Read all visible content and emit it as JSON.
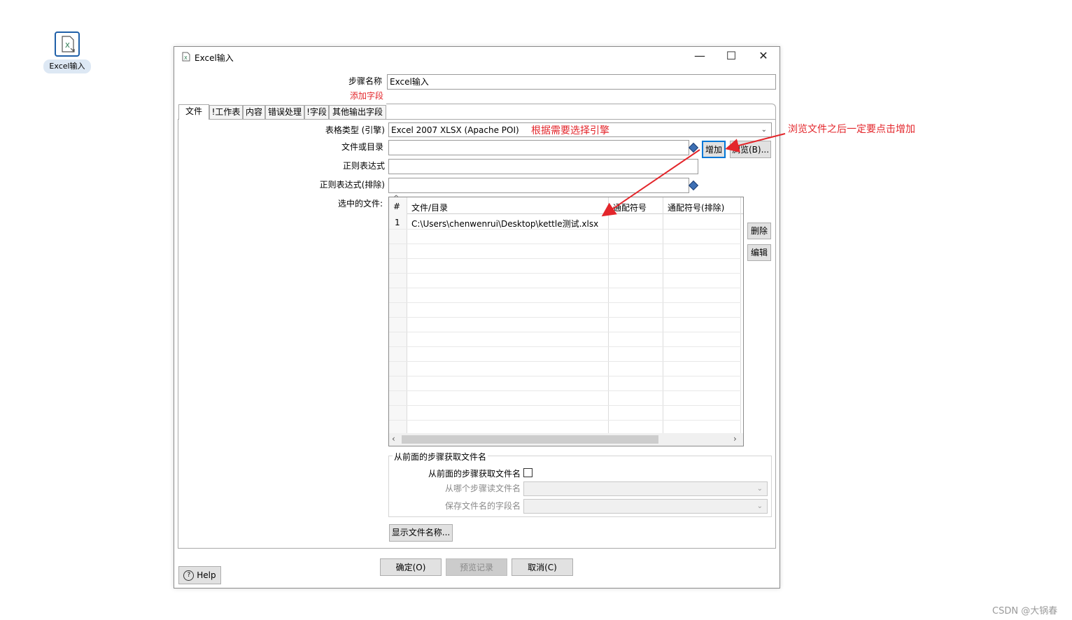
{
  "desktop": {
    "step_label": "Excel输入"
  },
  "dialog": {
    "title": "Excel输入",
    "controls": {
      "minimize": "—",
      "maximize": "☐",
      "close": "✕"
    },
    "step_name_label": "步骤名称",
    "step_name_value": "Excel输入",
    "add_fields_label": "添加字段",
    "tabs": [
      "文件",
      "!工作表",
      "内容",
      "错误处理",
      "!字段",
      "其他输出字段"
    ],
    "file_tab": {
      "spreadsheet_type_label": "表格类型 (引擎)",
      "spreadsheet_type_value": "Excel 2007 XLSX (Apache POI)",
      "file_or_dir_label": "文件或目录",
      "file_or_dir_value": "",
      "regex_label": "正则表达式",
      "regex_value": "",
      "regex_exclude_label": "正则表达式(排除)",
      "regex_exclude_value": "",
      "selected_files_label": "选中的文件:",
      "add_button": "增加",
      "browse_button": "浏览(B)...",
      "delete_button": "删除",
      "edit_button": "编辑",
      "table": {
        "columns": [
          "#",
          "文件/目录",
          "通配符号",
          "通配符号(排除)"
        ],
        "rows": [
          {
            "num": "1",
            "path": "C:\\Users\\chenwenrui\\Desktop\\kettle测试.xlsx",
            "wildcard": "",
            "wildcard_exclude": ""
          }
        ]
      },
      "prev_step_group_label": "从前面的步骤获取文件名",
      "prev_step_checkbox_label": "从前面的步骤获取文件名",
      "read_from_step_label": "从哪个步骤读文件名",
      "filename_field_label": "保存文件名的字段名",
      "show_filenames_button": "显示文件名称..."
    },
    "footer": {
      "ok_button": "确定(O)",
      "preview_button": "预览记录",
      "cancel_button": "取消(C)",
      "help_button": "Help"
    }
  },
  "annotations": {
    "engine_note": "根据需要选择引擎",
    "add_note": "浏览文件之后一定要点击增加",
    "color": "#e3262b"
  },
  "watermark": "CSDN @大锅春"
}
